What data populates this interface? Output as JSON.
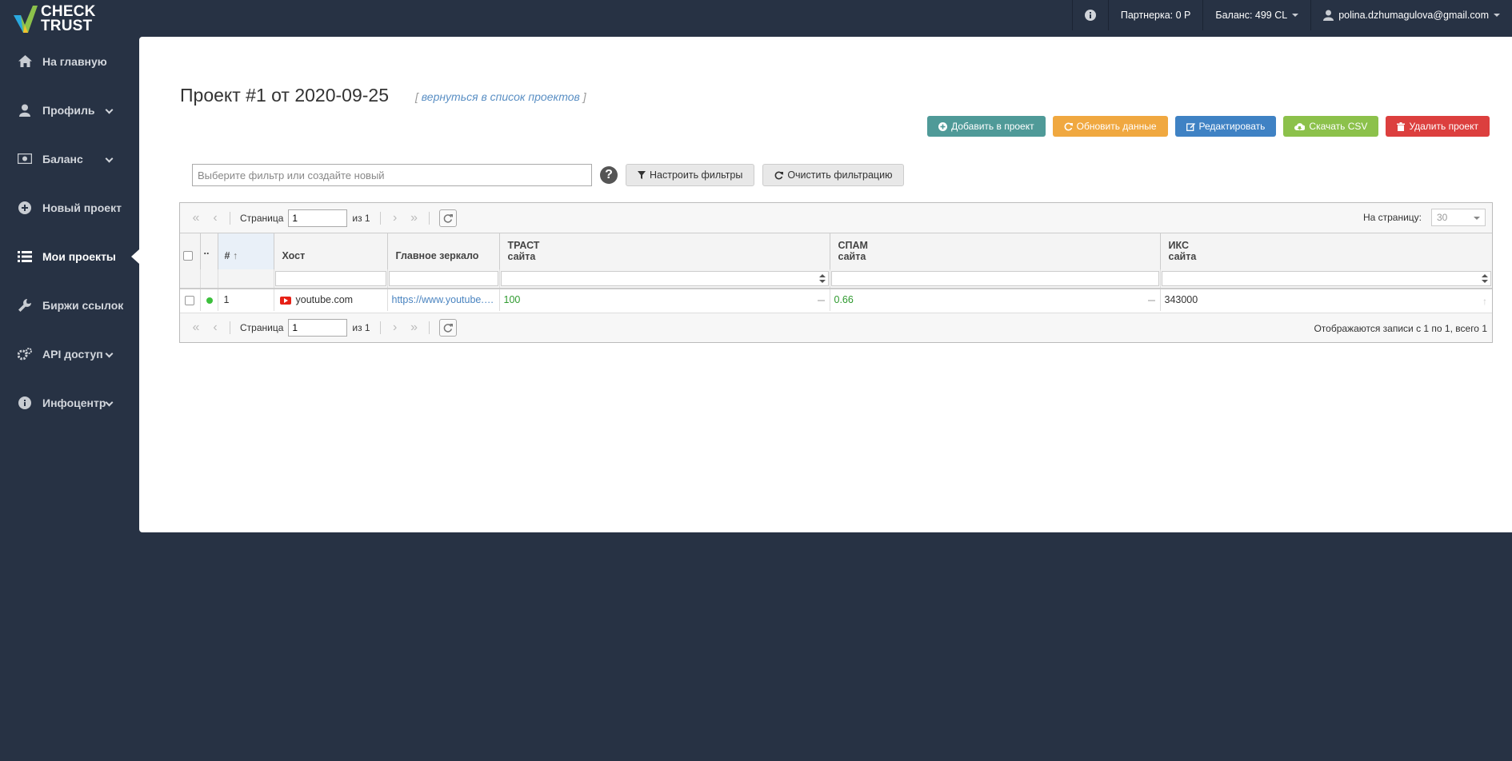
{
  "brand": {
    "line1": "CHECK",
    "line2": "TRUST"
  },
  "topbar": {
    "partner": "Партнерка: 0 Р",
    "balance": "Баланс: 499 CL",
    "user": "polina.dzhumagulova@gmail.com"
  },
  "sidebar": {
    "items": [
      {
        "label": "На главную"
      },
      {
        "label": "Профиль"
      },
      {
        "label": "Баланс"
      },
      {
        "label": "Новый проект"
      },
      {
        "label": "Мои проекты"
      },
      {
        "label": "Биржи ссылок"
      },
      {
        "label": "API доступ"
      },
      {
        "label": "Инфоцентр"
      }
    ]
  },
  "page": {
    "title": "Проект #1 от 2020-09-25",
    "back_link": "вернуться в список проектов"
  },
  "actions": {
    "add": "Добавить в проект",
    "refresh": "Обновить данные",
    "edit": "Редактировать",
    "csv": "Скачать CSV",
    "delete": "Удалить проект"
  },
  "filter": {
    "placeholder": "Выберите фильтр или создайте новый",
    "help": "?",
    "setup": "Настроить фильтры",
    "clear": "Очистить фильтрацию"
  },
  "pager": {
    "page_label": "Страница",
    "page_value": "1",
    "of_label": "из 1",
    "per_page_label": "На страницу:",
    "per_page_value": "30",
    "records": "Отображаются записи с 1 по 1, всего 1"
  },
  "table": {
    "headers": {
      "dots": "..",
      "num": "#",
      "host": "Хост",
      "mirror": "Главное зеркало",
      "trust_1": "ТРАСТ",
      "trust_2": "сайта",
      "spam_1": "СПАМ",
      "spam_2": "сайта",
      "iks_1": "ИКС",
      "iks_2": "сайта"
    },
    "rows": [
      {
        "num": "1",
        "host": "youtube.com",
        "mirror": "https://www.youtube.com/",
        "trust": "100",
        "spam": "0.66",
        "iks": "343000"
      }
    ]
  },
  "colors": {
    "bg": "#273244",
    "teal": "#4f9a98",
    "orange": "#f0a840",
    "blue": "#3f82c4",
    "green": "#8cc14b",
    "red": "#dc3f3e"
  }
}
